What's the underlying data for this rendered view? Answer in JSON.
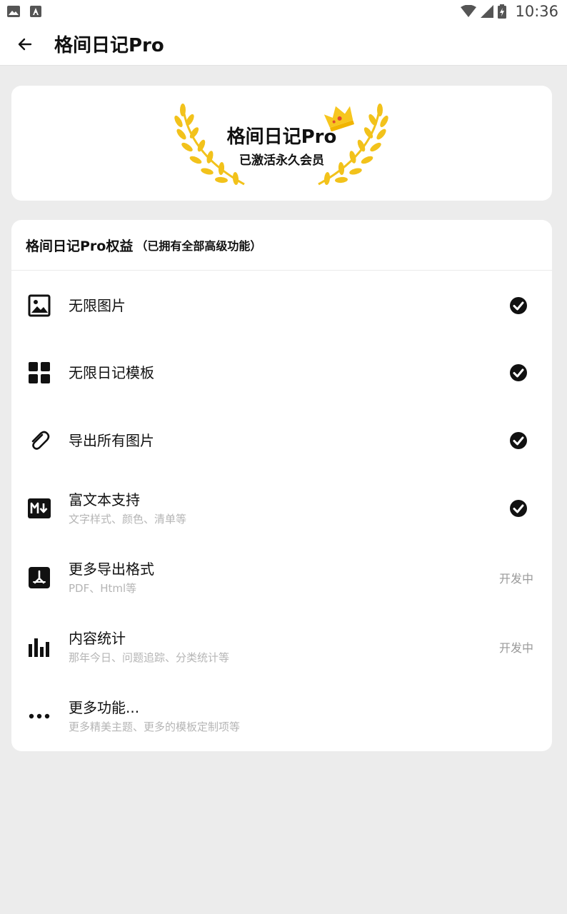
{
  "status_bar": {
    "time": "10:36"
  },
  "app_bar": {
    "title": "格间日记Pro"
  },
  "badge": {
    "title": "格间日记Pro",
    "subtitle": "已激活永久会员"
  },
  "benefits": {
    "title": "格间日记Pro权益",
    "note": "（已拥有全部高级功能）",
    "items": [
      {
        "label": "无限图片",
        "sub": "",
        "icon": "image-icon",
        "status": "check"
      },
      {
        "label": "无限日记模板",
        "sub": "",
        "icon": "grid-icon",
        "status": "check"
      },
      {
        "label": "导出所有图片",
        "sub": "",
        "icon": "paperclip-icon",
        "status": "check"
      },
      {
        "label": "富文本支持",
        "sub": "文字样式、颜色、清单等",
        "icon": "markdown-icon",
        "status": "check"
      },
      {
        "label": "更多导出格式",
        "sub": "PDF、Html等",
        "icon": "pdf-icon",
        "status": "开发中"
      },
      {
        "label": "内容统计",
        "sub": "那年今日、问题追踪、分类统计等",
        "icon": "bar-chart-icon",
        "status": "开发中"
      },
      {
        "label": "更多功能...",
        "sub": "更多精美主题、更多的模板定制项等",
        "icon": "more-icon",
        "status": ""
      }
    ]
  },
  "colors": {
    "gold": "#f2c21b",
    "background": "#ececec",
    "card": "#ffffff"
  }
}
